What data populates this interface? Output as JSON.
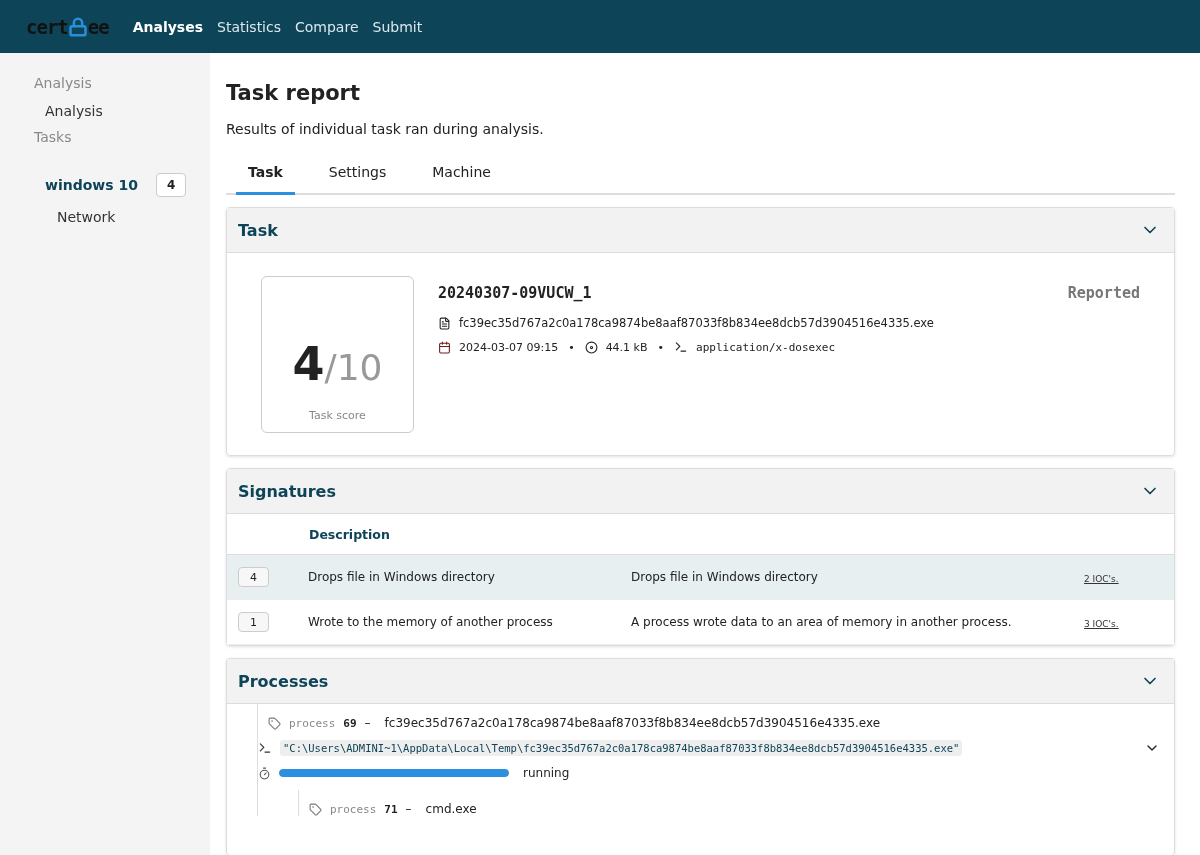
{
  "nav": {
    "logo_left": "cert",
    "logo_right": "ee",
    "links": [
      {
        "label": "Analyses",
        "selected": true
      },
      {
        "label": "Statistics",
        "selected": false
      },
      {
        "label": "Compare",
        "selected": false
      },
      {
        "label": "Submit",
        "selected": false
      }
    ]
  },
  "sidebar": {
    "sections": [
      {
        "heading": "Analysis",
        "items": [
          {
            "label": "Analysis",
            "selected": false
          }
        ]
      },
      {
        "heading": "Tasks",
        "items": [
          {
            "label": "windows 10",
            "badge": "4",
            "selected": true,
            "children": [
              {
                "label": "Network",
                "selected": false
              }
            ]
          }
        ]
      }
    ]
  },
  "page": {
    "title": "Task report",
    "subtitle": "Results of individual task ran during analysis."
  },
  "tabs": [
    {
      "label": "Task",
      "selected": true
    },
    {
      "label": "Settings",
      "selected": false
    },
    {
      "label": "Machine",
      "selected": false
    }
  ],
  "task_panel": {
    "title": "Task",
    "expanded": true,
    "score": "4",
    "score_max": "/10",
    "score_label": "Task score",
    "task_id": "20240307-09VUCW_1",
    "status": "Reported",
    "filename": "fc39ec35d767a2c0a178ca9874be8aaf87033f8b834ee8dcb57d3904516e4335.exe",
    "date": "2024-03-07 09:15",
    "separator": "•",
    "size": "44.1 kB",
    "mime": "application/x-dosexec"
  },
  "signatures_panel": {
    "title": "Signatures",
    "expanded": true,
    "columns": [
      "Description"
    ],
    "rows": [
      {
        "score": "4",
        "name": "Drops file in Windows directory",
        "description": "Drops file in Windows directory",
        "iocs": "2 IOC's.",
        "selected": true
      },
      {
        "score": "1",
        "name": "Wrote to the memory of another process",
        "description": "A process wrote data to an area of memory in another process.",
        "iocs": "3 IOC's.",
        "selected": false
      }
    ]
  },
  "processes_panel": {
    "title": "Processes",
    "expanded": true,
    "processes": [
      {
        "label": "process",
        "pid": "69",
        "sep": "–",
        "name": "fc39ec35d767a2c0a178ca9874be8aaf87033f8b834ee8dcb57d3904516e4335.exe",
        "command": "\"C:\\Users\\ADMINI~1\\AppData\\Local\\Temp\\fc39ec35d767a2c0a178ca9874be8aaf87033f8b834ee8dcb57d3904516e4335.exe\"",
        "level": 1,
        "state": "running",
        "children": [
          {
            "label": "process",
            "pid": "71",
            "sep": "–",
            "name": "cmd.exe"
          }
        ]
      }
    ]
  }
}
